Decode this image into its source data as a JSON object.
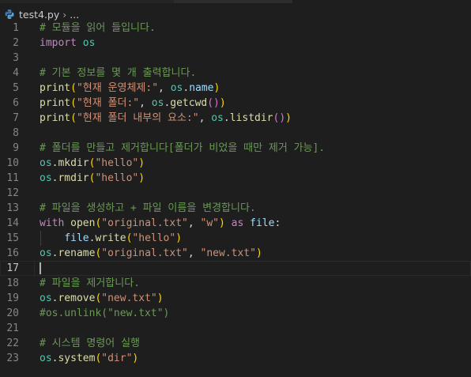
{
  "breadcrumb": {
    "file": "test4.py",
    "separator": "›",
    "more": "..."
  },
  "colors": {
    "comment": "#6a9955",
    "keyword": "#c586c0",
    "function": "#dcdcaa",
    "module": "#4ec9b0",
    "property": "#9cdcfe",
    "string": "#ce9178",
    "bracket1": "#ffd700",
    "bracket2": "#da70d6",
    "background": "#1e1e1e"
  },
  "editor": {
    "active_line": 17,
    "lines": [
      {
        "n": "1",
        "tokens": [
          {
            "t": "c",
            "s": "# 모듈을 읽어 들입니다."
          }
        ]
      },
      {
        "n": "2",
        "tokens": [
          {
            "t": "k",
            "s": "import"
          },
          {
            "t": "w",
            "s": " "
          },
          {
            "t": "m",
            "s": "os"
          }
        ]
      },
      {
        "n": "3",
        "tokens": []
      },
      {
        "n": "4",
        "tokens": [
          {
            "t": "c",
            "s": "# 기본 정보를 몇 개 출력합니다."
          }
        ]
      },
      {
        "n": "5",
        "tokens": [
          {
            "t": "f",
            "s": "print"
          },
          {
            "t": "b1",
            "s": "("
          },
          {
            "t": "s",
            "s": "\"현재 운영체제:\""
          },
          {
            "t": "w",
            "s": ", "
          },
          {
            "t": "m",
            "s": "os"
          },
          {
            "t": "w",
            "s": "."
          },
          {
            "t": "p",
            "s": "name"
          },
          {
            "t": "b1",
            "s": ")"
          }
        ]
      },
      {
        "n": "6",
        "tokens": [
          {
            "t": "f",
            "s": "print"
          },
          {
            "t": "b1",
            "s": "("
          },
          {
            "t": "s",
            "s": "\"현재 폴더:\""
          },
          {
            "t": "w",
            "s": ", "
          },
          {
            "t": "m",
            "s": "os"
          },
          {
            "t": "w",
            "s": "."
          },
          {
            "t": "f",
            "s": "getcwd"
          },
          {
            "t": "b2",
            "s": "()"
          },
          {
            "t": "b1",
            "s": ")"
          }
        ]
      },
      {
        "n": "7",
        "tokens": [
          {
            "t": "f",
            "s": "print"
          },
          {
            "t": "b1",
            "s": "("
          },
          {
            "t": "s",
            "s": "\"현재 폴더 내부의 요소:\""
          },
          {
            "t": "w",
            "s": ", "
          },
          {
            "t": "m",
            "s": "os"
          },
          {
            "t": "w",
            "s": "."
          },
          {
            "t": "f",
            "s": "listdir"
          },
          {
            "t": "b2",
            "s": "()"
          },
          {
            "t": "b1",
            "s": ")"
          }
        ]
      },
      {
        "n": "8",
        "tokens": []
      },
      {
        "n": "9",
        "tokens": [
          {
            "t": "c",
            "s": "# 폴더를 만들고 제거합니다[폴더가 비었을 때만 제거 가능]."
          }
        ]
      },
      {
        "n": "10",
        "tokens": [
          {
            "t": "m",
            "s": "os"
          },
          {
            "t": "w",
            "s": "."
          },
          {
            "t": "f",
            "s": "mkdir"
          },
          {
            "t": "b1",
            "s": "("
          },
          {
            "t": "s",
            "s": "\"hello\""
          },
          {
            "t": "b1",
            "s": ")"
          }
        ]
      },
      {
        "n": "11",
        "tokens": [
          {
            "t": "m",
            "s": "os"
          },
          {
            "t": "w",
            "s": "."
          },
          {
            "t": "f",
            "s": "rmdir"
          },
          {
            "t": "b1",
            "s": "("
          },
          {
            "t": "s",
            "s": "\"hello\""
          },
          {
            "t": "b1",
            "s": ")"
          }
        ]
      },
      {
        "n": "12",
        "tokens": []
      },
      {
        "n": "13",
        "tokens": [
          {
            "t": "c",
            "s": "# 파일을 생성하고 + 파일 이름을 변경합니다."
          }
        ]
      },
      {
        "n": "14",
        "tokens": [
          {
            "t": "k",
            "s": "with"
          },
          {
            "t": "w",
            "s": " "
          },
          {
            "t": "f",
            "s": "open"
          },
          {
            "t": "b1",
            "s": "("
          },
          {
            "t": "s",
            "s": "\"original.txt\""
          },
          {
            "t": "w",
            "s": ", "
          },
          {
            "t": "s",
            "s": "\"w\""
          },
          {
            "t": "b1",
            "s": ")"
          },
          {
            "t": "w",
            "s": " "
          },
          {
            "t": "k",
            "s": "as"
          },
          {
            "t": "w",
            "s": " "
          },
          {
            "t": "p",
            "s": "file"
          },
          {
            "t": "w",
            "s": ":"
          }
        ]
      },
      {
        "n": "15",
        "tokens": [
          {
            "t": "w",
            "s": "    "
          },
          {
            "t": "p",
            "s": "file"
          },
          {
            "t": "w",
            "s": "."
          },
          {
            "t": "f",
            "s": "write"
          },
          {
            "t": "b1",
            "s": "("
          },
          {
            "t": "s",
            "s": "\"hello\""
          },
          {
            "t": "b1",
            "s": ")"
          }
        ]
      },
      {
        "n": "16",
        "tokens": [
          {
            "t": "m",
            "s": "os"
          },
          {
            "t": "w",
            "s": "."
          },
          {
            "t": "f",
            "s": "rename"
          },
          {
            "t": "b1",
            "s": "("
          },
          {
            "t": "s",
            "s": "\"original.txt\""
          },
          {
            "t": "w",
            "s": ", "
          },
          {
            "t": "s",
            "s": "\"new.txt\""
          },
          {
            "t": "b1",
            "s": ")"
          }
        ]
      },
      {
        "n": "17",
        "tokens": []
      },
      {
        "n": "18",
        "tokens": [
          {
            "t": "c",
            "s": "# 파일을 제거합니다."
          }
        ]
      },
      {
        "n": "19",
        "tokens": [
          {
            "t": "m",
            "s": "os"
          },
          {
            "t": "w",
            "s": "."
          },
          {
            "t": "f",
            "s": "remove"
          },
          {
            "t": "b1",
            "s": "("
          },
          {
            "t": "s",
            "s": "\"new.txt\""
          },
          {
            "t": "b1",
            "s": ")"
          }
        ]
      },
      {
        "n": "20",
        "tokens": [
          {
            "t": "c",
            "s": "#os.unlink(\"new.txt\")"
          }
        ]
      },
      {
        "n": "21",
        "tokens": []
      },
      {
        "n": "22",
        "tokens": [
          {
            "t": "c",
            "s": "# 시스템 명령어 실행"
          }
        ]
      },
      {
        "n": "23",
        "tokens": [
          {
            "t": "m",
            "s": "os"
          },
          {
            "t": "w",
            "s": "."
          },
          {
            "t": "f",
            "s": "system"
          },
          {
            "t": "b1",
            "s": "("
          },
          {
            "t": "s",
            "s": "\"dir\""
          },
          {
            "t": "b1",
            "s": ")"
          }
        ]
      }
    ]
  }
}
